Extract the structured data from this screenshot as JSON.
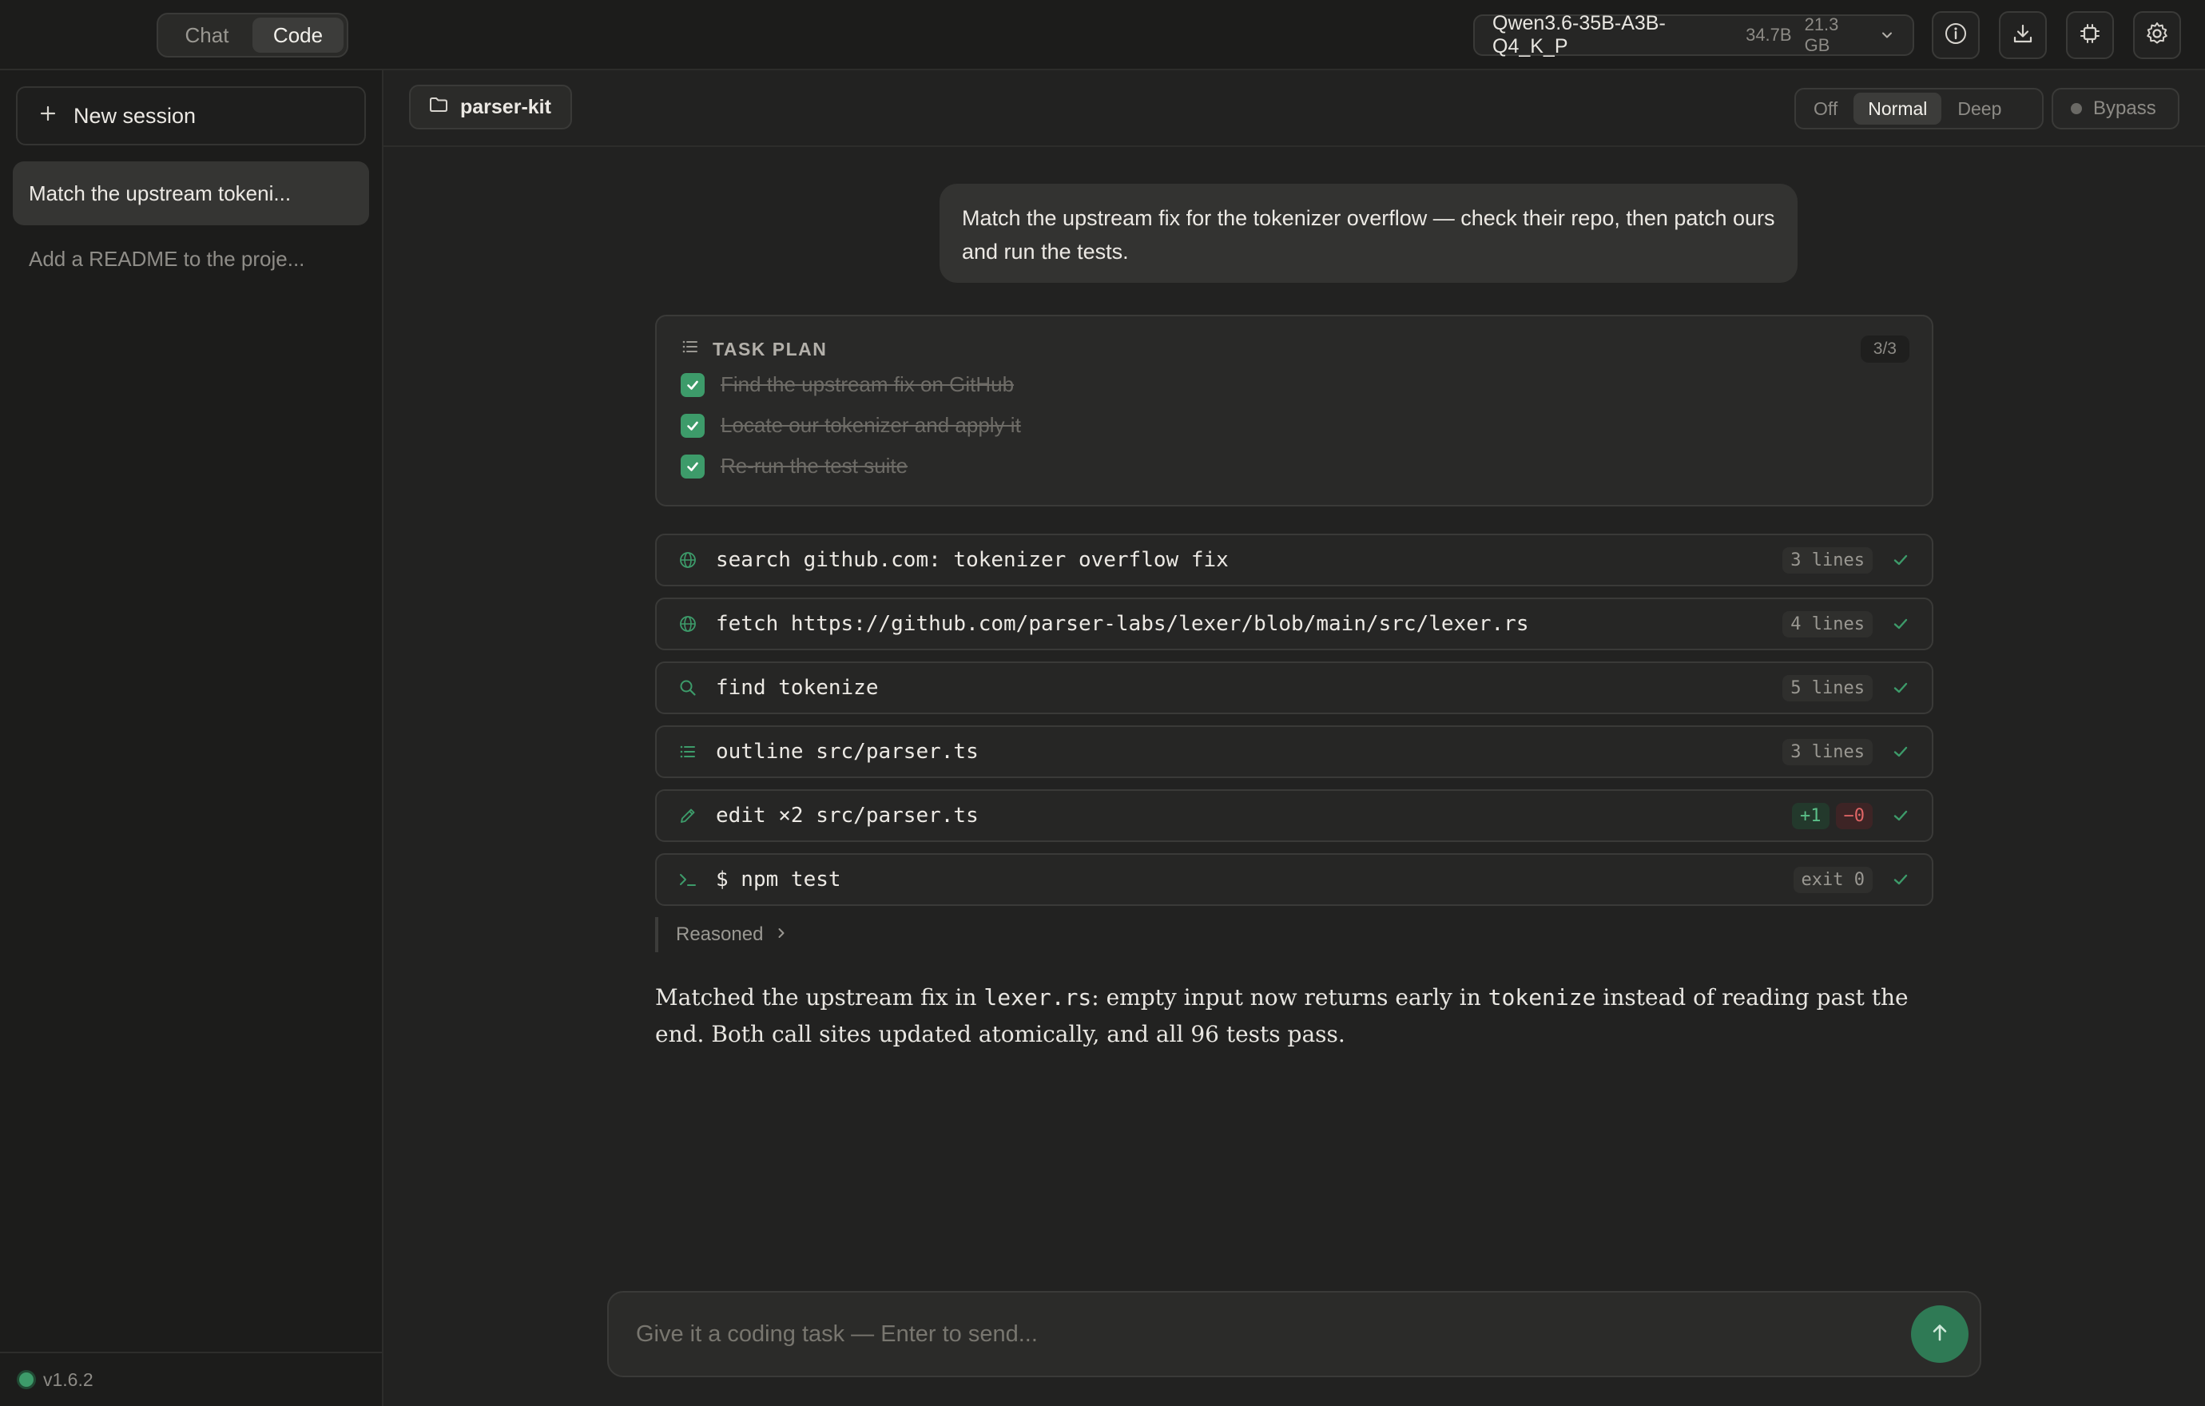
{
  "topbar": {
    "modes": [
      {
        "label": "Chat",
        "active": false
      },
      {
        "label": "Code",
        "active": true
      }
    ],
    "model": {
      "name": "Qwen3.6-35B-A3B-Q4_K_P",
      "params": "34.7B",
      "size": "21.3 GB"
    },
    "icons": [
      "info-icon",
      "download-icon",
      "chip-icon",
      "gear-icon"
    ]
  },
  "sidebar": {
    "new_session_label": "New session",
    "sessions": [
      {
        "label": "Match the upstream tokeni...",
        "active": true
      },
      {
        "label": "Add a README to the proje...",
        "active": false
      }
    ],
    "version": "v1.6.2"
  },
  "subbar": {
    "project": "parser-kit",
    "effort_options": [
      {
        "label": "Off",
        "active": false
      },
      {
        "label": "Normal",
        "active": true
      },
      {
        "label": "Deep",
        "active": false
      }
    ],
    "bypass_label": "Bypass"
  },
  "conversation": {
    "user_message": "Match the upstream fix for the tokenizer overflow — check their repo, then patch ours and run the tests.",
    "plan": {
      "title": "TASK PLAN",
      "count": "3/3",
      "items": [
        "Find the upstream fix on GitHub",
        "Locate our tokenizer and apply it",
        "Re-run the test suite"
      ]
    },
    "tools": [
      {
        "icon": "globe-icon",
        "text": "search github.com: tokenizer overflow fix",
        "meta": "3 lines"
      },
      {
        "icon": "globe-icon",
        "text": "fetch https://github.com/parser-labs/lexer/blob/main/src/lexer.rs",
        "meta": "4 lines"
      },
      {
        "icon": "search-icon",
        "text": "find tokenize",
        "meta": "5 lines"
      },
      {
        "icon": "list-icon",
        "text": "outline src/parser.ts",
        "meta": "3 lines"
      },
      {
        "icon": "pencil-icon",
        "text": "edit ×2 src/parser.ts",
        "add": "+1",
        "del": "−0"
      },
      {
        "icon": "terminal-icon",
        "text": "$ npm test",
        "meta": "exit 0"
      }
    ],
    "reasoned_label": "Reasoned",
    "answer": {
      "p1": "Matched the upstream fix in ",
      "code1": "lexer.rs",
      "p2": ": empty input now returns early in ",
      "code2": "tokenize",
      "p3": " instead of reading past the end. Both call sites updated atomically, and all 96 tests pass."
    }
  },
  "composer": {
    "placeholder": "Give it a coding task — Enter to send..."
  },
  "colors": {
    "accent_green": "#3d9b6a",
    "background": "#222221",
    "sidebar": "#1c1c1b"
  }
}
